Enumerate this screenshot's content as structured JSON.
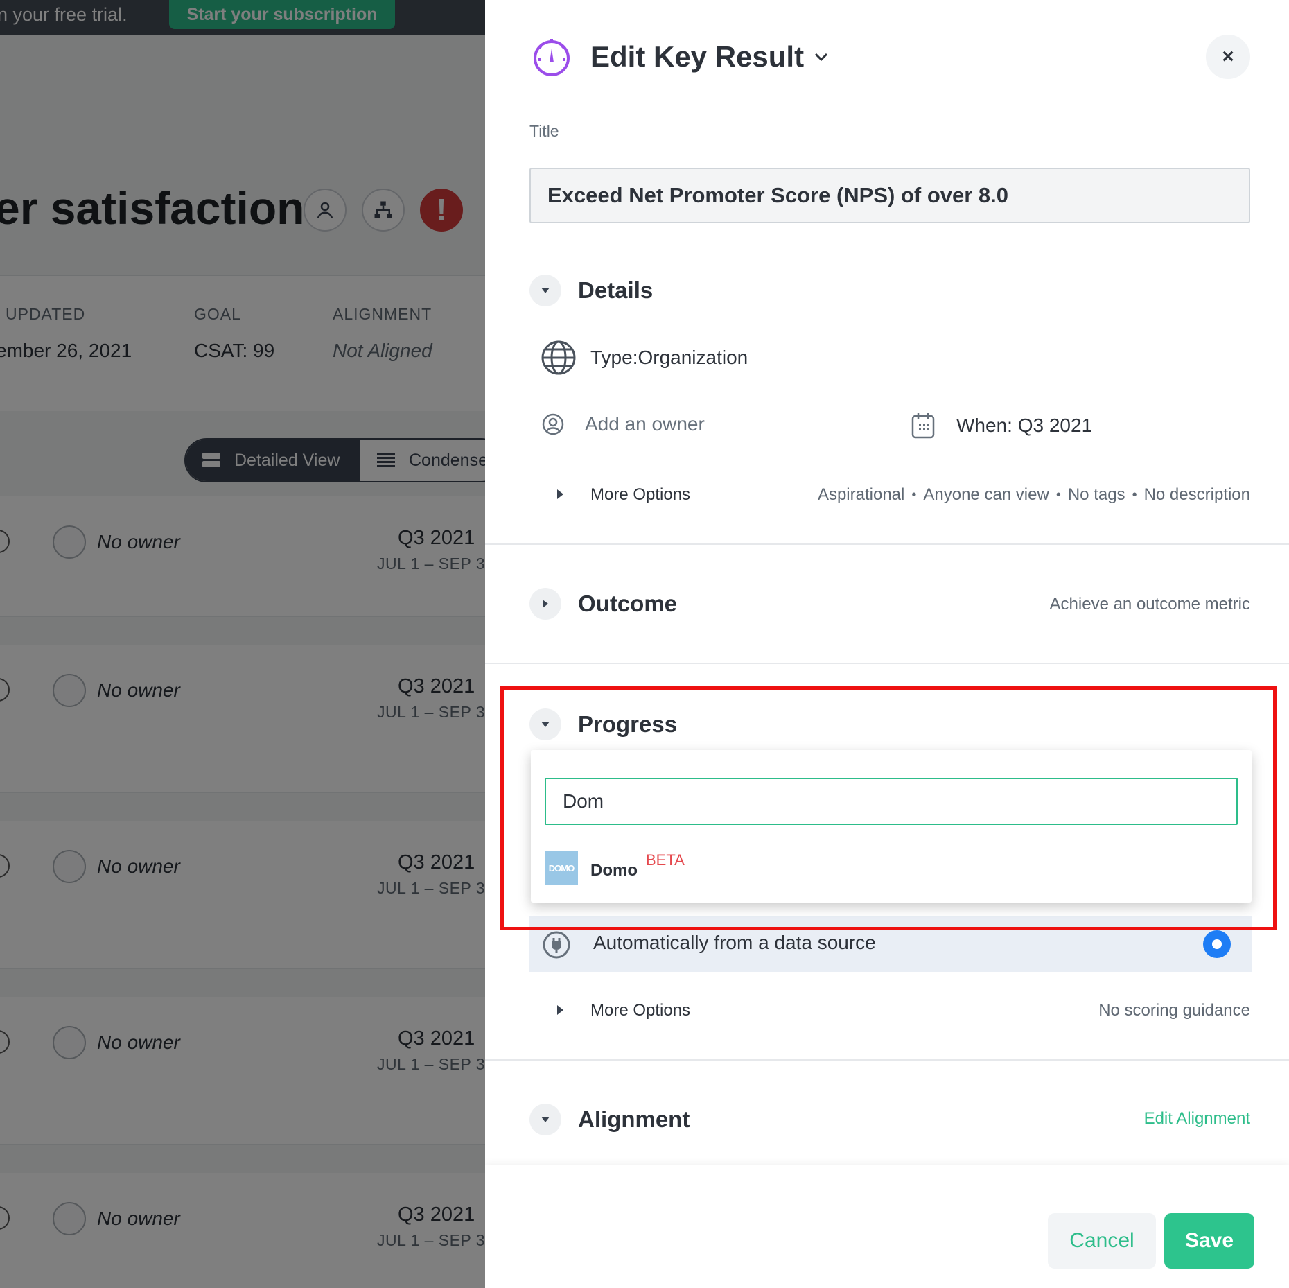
{
  "background": {
    "trial_text": "n your free trial.",
    "trial_button": "Start your subscription",
    "objective_title": "er satisfaction",
    "meta": {
      "updated_label": "UPDATED",
      "updated_value": "ember 26, 2021",
      "goal_label": "GOAL",
      "goal_value": "CSAT: 99",
      "alignment_label": "ALIGNMENT",
      "alignment_value": "Not Aligned"
    },
    "view_toggle": {
      "detailed": "Detailed View",
      "condensed": "Condense"
    },
    "key_results": [
      {
        "owner": "No owner",
        "quarter": "Q3 2021",
        "range": "JUL 1 – SEP 3"
      },
      {
        "owner": "No owner",
        "quarter": "Q3 2021",
        "range": "JUL 1 – SEP 3"
      },
      {
        "owner": "No owner",
        "quarter": "Q3 2021",
        "range": "JUL 1 – SEP 3"
      },
      {
        "owner": "No owner",
        "quarter": "Q3 2021",
        "range": "JUL 1 – SEP 3"
      },
      {
        "owner": "No owner",
        "quarter": "Q3 2021",
        "range": "JUL 1 – SEP 3"
      }
    ]
  },
  "panel": {
    "header_title": "Edit Key Result",
    "close": "×",
    "title_label": "Title",
    "title_value": "Exceed Net Promoter Score (NPS) of over 8.0",
    "details": {
      "heading": "Details",
      "type_label": "Type:",
      "type_value": "Organization",
      "owner_placeholder": "Add an owner",
      "when_label": "When:",
      "when_value": "Q3 2021",
      "more_options": "More Options",
      "summary": [
        "Aspirational",
        "Anyone can view",
        "No tags",
        "No description"
      ]
    },
    "outcome": {
      "heading": "Outcome",
      "hint": "Achieve an outcome metric"
    },
    "progress": {
      "heading": "Progress",
      "search_value": "Dom",
      "result_name": "Domo",
      "result_logo_text": "DOMO",
      "result_badge": "BETA",
      "auto_label": "Automatically from a data source",
      "more_options": "More Options",
      "more_summary": "No scoring guidance"
    },
    "alignment": {
      "heading": "Alignment",
      "edit_link": "Edit Alignment"
    },
    "footer": {
      "cancel": "Cancel",
      "save": "Save"
    }
  },
  "colors": {
    "accent_green": "#2dbd8a",
    "highlight_red": "#ee1111",
    "radio_blue": "#1e7df5",
    "beta_red": "#e5484d",
    "icon_purple": "#9b4dea"
  },
  "icons": [
    "key-result-gauge-icon",
    "chevron-down-icon",
    "close-icon",
    "globe-icon",
    "user-circle-icon",
    "calendar-icon",
    "caret-right-icon",
    "plug-icon"
  ]
}
